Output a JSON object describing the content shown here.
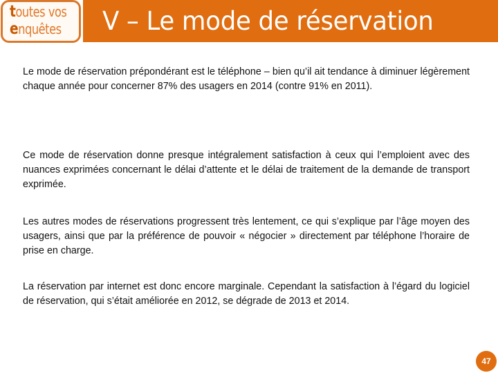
{
  "logo": {
    "line1_first": "t",
    "line1_rest": "outes vos",
    "line2_first": "e",
    "line2_rest": "nquêtes"
  },
  "header": {
    "title": "V – Le mode de réservation"
  },
  "paragraphs": [
    "Le mode de réservation prépondérant est le téléphone – bien qu’il ait tendance à diminuer légèrement chaque année pour concerner 87% des usagers en 2014 (contre 91% en 2011).",
    "Ce mode de réservation donne presque intégralement satisfaction à ceux qui l’emploient avec des nuances exprimées concernant le délai d’attente et le délai de traitement de la demande de transport exprimée.",
    "Les autres modes de réservations progressent très lentement, ce qui s’explique par l’âge moyen des usagers, ainsi que par la préférence de pouvoir « négocier » directement par téléphone l’horaire de prise en charge.",
    "La réservation par internet est donc encore marginale. Cependant la satisfaction à l’égard du logiciel de réservation, qui s’était améliorée en 2012, se dégrade de 2013 et 2014."
  ],
  "footer": {
    "page_number": "47"
  },
  "colors": {
    "accent": "#e06d10",
    "logo_border": "#d9782a",
    "text": "#111111"
  }
}
